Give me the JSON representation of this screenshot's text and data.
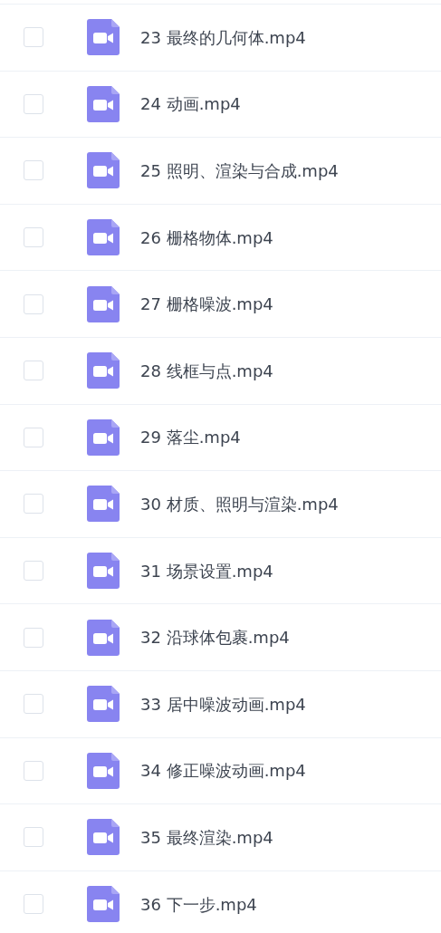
{
  "files": [
    {
      "name": "23 最终的几何体.mp4",
      "checked": false
    },
    {
      "name": "24 动画.mp4",
      "checked": false
    },
    {
      "name": "25 照明、渲染与合成.mp4",
      "checked": false
    },
    {
      "name": "26 栅格物体.mp4",
      "checked": false
    },
    {
      "name": "27 栅格噪波.mp4",
      "checked": false
    },
    {
      "name": "28 线框与点.mp4",
      "checked": false
    },
    {
      "name": "29 落尘.mp4",
      "checked": false
    },
    {
      "name": "30 材质、照明与渲染.mp4",
      "checked": false
    },
    {
      "name": "31 场景设置.mp4",
      "checked": false
    },
    {
      "name": "32 沿球体包裹.mp4",
      "checked": false
    },
    {
      "name": "33 居中噪波动画.mp4",
      "checked": false
    },
    {
      "name": "34 修正噪波动画.mp4",
      "checked": false
    },
    {
      "name": "35 最终渲染.mp4",
      "checked": false
    },
    {
      "name": "36 下一步.mp4",
      "checked": false
    }
  ]
}
